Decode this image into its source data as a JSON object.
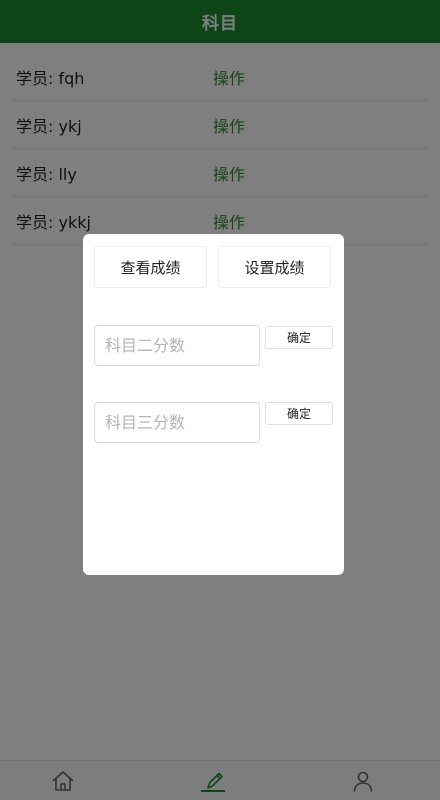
{
  "header": {
    "title": "科目"
  },
  "students": [
    {
      "label": "学员: fqh",
      "action": "操作"
    },
    {
      "label": "学员: ykj",
      "action": "操作"
    },
    {
      "label": "学员: lly",
      "action": "操作"
    },
    {
      "label": "学员: ykkj",
      "action": "操作"
    }
  ],
  "modal": {
    "view_scores_label": "查看成绩",
    "set_scores_label": "设置成绩",
    "subject2": {
      "placeholder": "科目二分数",
      "value": "",
      "confirm_label": "确定"
    },
    "subject3": {
      "placeholder": "科目三分数",
      "value": "",
      "confirm_label": "确定"
    }
  },
  "tabbar": {
    "items": [
      {
        "icon": "home-icon",
        "active": false
      },
      {
        "icon": "edit-icon",
        "active": true
      },
      {
        "icon": "user-icon",
        "active": false
      }
    ]
  },
  "colors": {
    "header_bg": "#1a8a2e",
    "action_text": "#2e8b2e",
    "overlay": "rgba(0,0,0,0.5)"
  }
}
